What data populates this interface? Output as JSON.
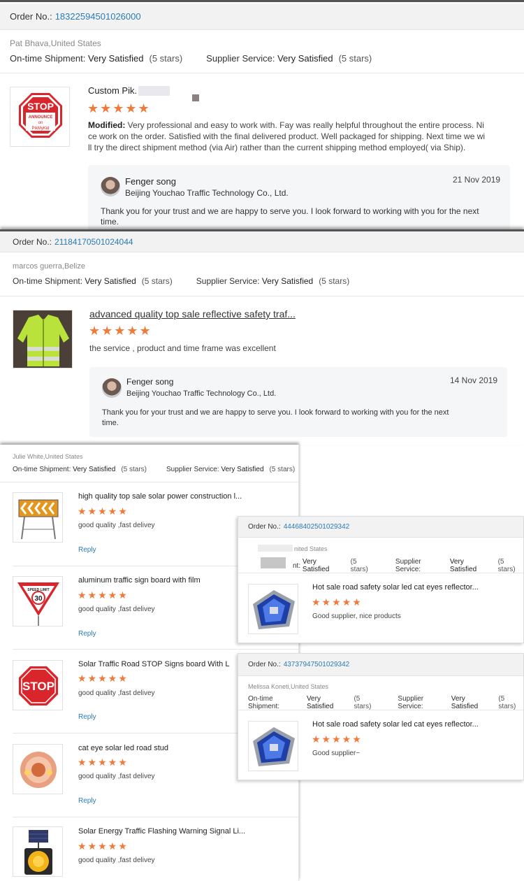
{
  "card1": {
    "order_label": "Order No.:",
    "order_number": "18322594501026000",
    "buyer": "Pat Bhava,United States",
    "shipment_label": "On-time Shipment:",
    "shipment_value": "Very Satisfied",
    "shipment_stars": "(5 stars)",
    "service_label": "Supplier Service:",
    "service_value": "Very Satisfied",
    "service_stars": "(5 stars)",
    "product_title": "Custom Pik.",
    "thumb_text_1": "STOP",
    "thumb_text_2": "ANNOUNCE",
    "thumb_text_3": "on",
    "thumb_text_4": "PikMyKid",
    "stars": "★★★★★",
    "review_prefix": "Modified:",
    "review_line1": "Very professional and easy to work with. Fay was really helpful throughout the entire process.  Ni",
    "review_line2": "ce work on the order. Satisfied with the final delivered product. Well packaged for shipping. Next time we wi",
    "review_line3": "ll try the direct shipment method (via Air) rather than the current shipping method employed( via Ship).",
    "reply_name": "Fenger song",
    "reply_company": "Beijing Youchao Traffic Technology Co., Ltd.",
    "reply_date": "21 Nov 2019",
    "reply_line1": "Thank you for your trust and we are happy to serve you. I look forward to working with you for the next",
    "reply_line2": "time."
  },
  "card2": {
    "order_label": "Order No.:",
    "order_number": "21184170501024044",
    "buyer": "marcos guerra,Belize",
    "shipment_label": "On-time Shipment:",
    "shipment_value": "Very Satisfied",
    "shipment_stars": "(5 stars)",
    "service_label": "Supplier Service:",
    "service_value": "Very Satisfied",
    "service_stars": "(5 stars)",
    "product_title": "advanced quality top sale reflective safety traf...",
    "stars": "★★★★★",
    "review": "the service , product and time frame was excellent",
    "reply_name": "Fenger song",
    "reply_company": "Beijing Youchao Traffic Technology Co., Ltd.",
    "reply_date": "14 Nov 2019",
    "reply_line1": "Thank you for your trust and we are happy to serve you. I look forward to working with you for the next",
    "reply_line2": "time."
  },
  "card3": {
    "buyer": "Julie White,United States",
    "shipment_label": "On-time Shipment:",
    "shipment_value": "Very Satisfied",
    "shipment_stars": "(5 stars)",
    "service_label": "Supplier Service:",
    "service_value": "Very Satisfied",
    "service_stars": "(5 stars)",
    "items": [
      {
        "title": "high quality top sale solar power construction l...",
        "stars": "★★★★★",
        "review": "good quality ,fast delivey",
        "reply": "Reply"
      },
      {
        "title": "aluminum traffic sign board with film",
        "stars": "★★★★★",
        "review": "good quality ,fast delivey",
        "reply": "Reply",
        "thumb_top": "SPEED LIMIT",
        "thumb_num": "30"
      },
      {
        "title": "Solar Traffic Road STOP Signs board With L",
        "stars": "★★★★★",
        "review": "good quality ,fast delivey",
        "reply": "Reply",
        "thumb_text": "STOP"
      },
      {
        "title": "cat eye solar led road stud",
        "stars": "★★★★★",
        "review": "good quality ,fast delivey",
        "reply": "Reply"
      },
      {
        "title": "Solar Energy Traffic Flashing Warning Signal Li...",
        "stars": "★★★★★",
        "review": "good quality ,fast delivey"
      }
    ]
  },
  "card4": {
    "order_label": "Order No.:",
    "order_number": "44468402501029342",
    "buyer": "nited States",
    "shipment_label": "nt:",
    "shipment_value": "Very Satisfied",
    "shipment_stars": "(5 stars)",
    "service_label": "Supplier Service:",
    "service_value": "Very Satisfied",
    "service_stars": "(5 stars)",
    "product_title": "Hot sale road safety solar led cat eyes reflector...",
    "stars": "★★★★★",
    "review": "Good supplier, nice products"
  },
  "card5": {
    "order_label": "Order No.:",
    "order_number": "43737947501029342",
    "buyer": "Melissa Koneti,United States",
    "shipment_label": "On-time Shipment:",
    "shipment_value": "Very Satisfied",
    "shipment_stars": "(5 stars)",
    "service_label": "Supplier Service:",
    "service_value": "Very Satisfied",
    "service_stars": "(5 stars)",
    "product_title": "Hot sale road safety solar led cat eyes reflector...",
    "stars": "★★★★★",
    "review": "Good supplier~"
  },
  "colors": {
    "star": "#f07a3a",
    "link": "#2b7bb9",
    "order_bar": "#f2f2f2",
    "reply_bg": "#f5f6f8"
  }
}
